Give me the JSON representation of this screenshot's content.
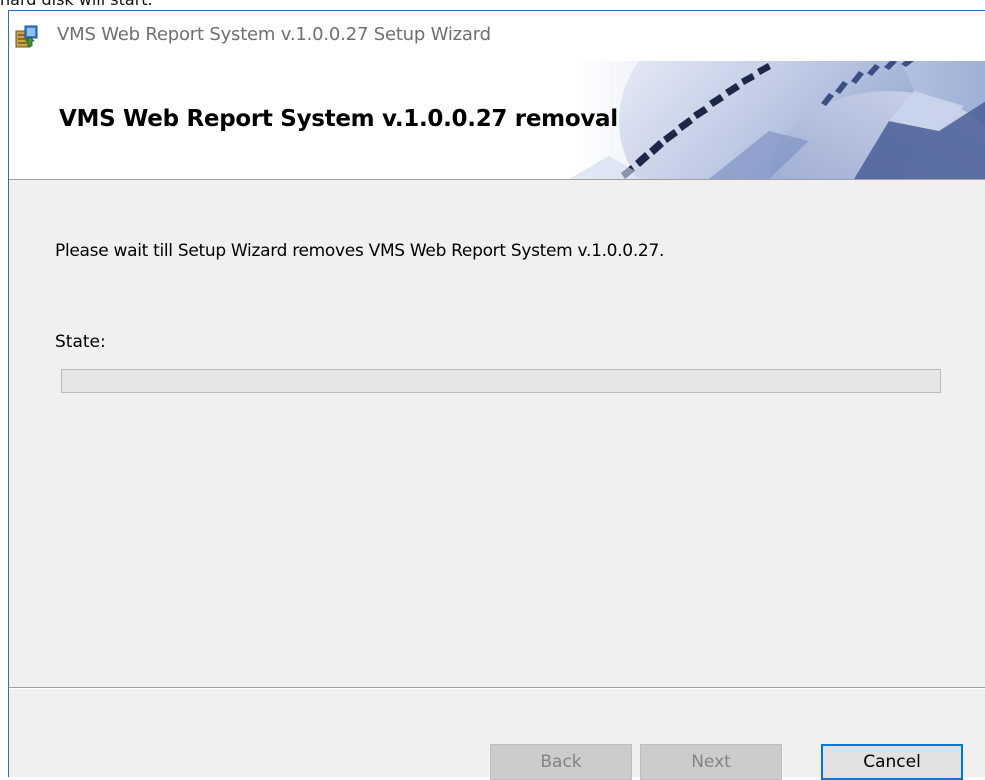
{
  "background_text": "hard disk will start.",
  "window": {
    "title": "VMS Web Report System v.1.0.0.27 Setup Wizard",
    "icon": "installer-icon"
  },
  "banner": {
    "title": "VMS Web Report System v.1.0.0.27 removal",
    "art": "gears-graphic"
  },
  "body": {
    "message": "Please wait till Setup Wizard removes VMS Web Report System v.1.0.0.27.",
    "state_label": "State:",
    "progress_fraction": 0
  },
  "buttons": {
    "back": "Back",
    "next": "Next",
    "cancel": "Cancel"
  },
  "colors": {
    "accent": "#0078d7",
    "window_border": "#2b71b8",
    "dialog_bg": "#f0f0f0"
  }
}
